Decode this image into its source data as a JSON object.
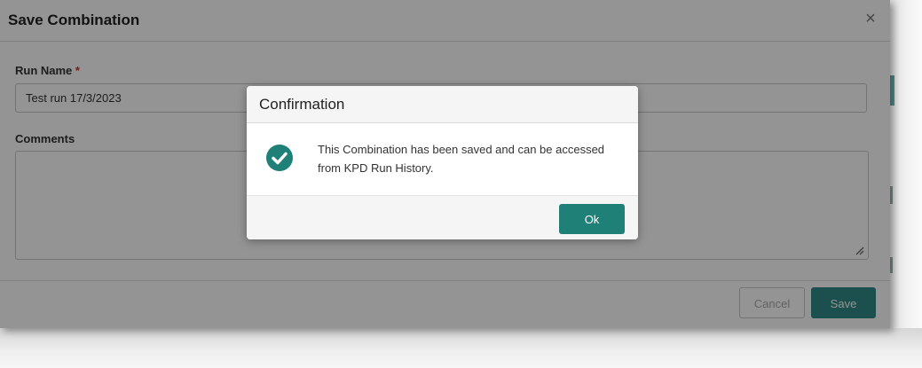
{
  "dialog": {
    "title": "Save Combination",
    "close_icon": "close-icon",
    "close_glyph": "×",
    "run_name_label": "Run Name",
    "required_marker": "*",
    "run_name_value": "Test run 17/3/2023",
    "comments_label": "Comments",
    "comments_value": "",
    "cancel_label": "Cancel",
    "save_label": "Save"
  },
  "confirmation": {
    "title": "Confirmation",
    "icon": "check-circle-icon",
    "message": "This Combination has been saved and can be accessed from KPD Run History.",
    "ok_label": "Ok"
  },
  "colors": {
    "accent": "#1f8078",
    "save_button": "#2f8a87",
    "check_icon": "#1f8078",
    "required": "#d0312d"
  }
}
